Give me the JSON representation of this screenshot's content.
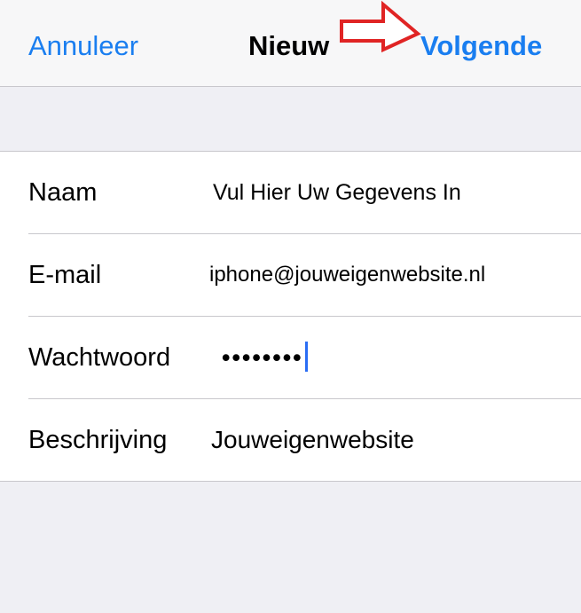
{
  "navbar": {
    "cancel_label": "Annuleer",
    "title": "Nieuw",
    "next_label": "Volgende"
  },
  "form": {
    "rows": [
      {
        "label": "Naam",
        "value": "Vul Hier Uw Gegevens In"
      },
      {
        "label": "E-mail",
        "value": "iphone@jouweigenwebsite.nl"
      },
      {
        "label": "Wachtwoord",
        "value": "••••••••"
      },
      {
        "label": "Beschrijving",
        "value": "Jouweigenwebsite"
      }
    ]
  },
  "colors": {
    "accent": "#1a7ef0",
    "annotation": "#e02424",
    "background": "#efeff4"
  },
  "icons": {
    "annotation": "red-arrow-icon"
  }
}
